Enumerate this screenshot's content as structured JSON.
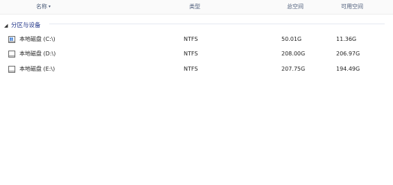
{
  "columns": {
    "name": "名称",
    "type": "类型",
    "total": "总空间",
    "free": "可用空间"
  },
  "group": {
    "title": "分区与设备"
  },
  "drives": [
    {
      "name": "本地磁盘 (C:\\)",
      "type": "NTFS",
      "total": "50.01G",
      "free": "11.36G",
      "icon": "system-drive-icon"
    },
    {
      "name": "本地磁盘 (D:\\)",
      "type": "NTFS",
      "total": "208.00G",
      "free": "206.97G",
      "icon": "drive-icon"
    },
    {
      "name": "本地磁盘 (E:\\)",
      "type": "NTFS",
      "total": "207.75G",
      "free": "194.49G",
      "icon": "drive-icon"
    }
  ]
}
